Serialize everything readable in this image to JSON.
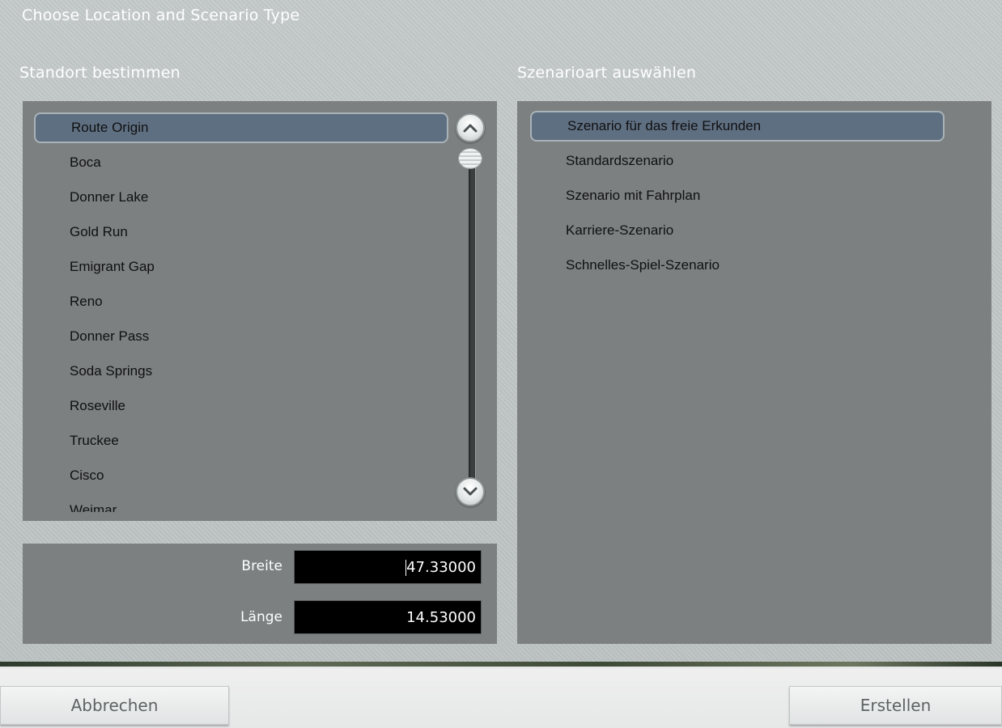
{
  "window": {
    "title": "Choose Location and Scenario Type"
  },
  "location": {
    "heading": "Standort bestimmen",
    "items": [
      "Route Origin",
      "Boca",
      "Donner Lake",
      "Gold Run",
      "Emigrant Gap",
      "Reno",
      "Donner Pass",
      "Soda Springs",
      "Roseville",
      "Truckee",
      "Cisco",
      "Weimar"
    ],
    "selected_index": 0
  },
  "coordinates": {
    "latitude_label": "Breite",
    "latitude_value": "47.33000",
    "longitude_label": "Länge",
    "longitude_value": "14.53000"
  },
  "scenario": {
    "heading": "Szenarioart auswählen",
    "items": [
      "Szenario für das freie Erkunden",
      "Standardszenario",
      "Szenario mit Fahrplan",
      "Karriere-Szenario",
      "Schnelles-Spiel-Szenario"
    ],
    "selected_index": 0
  },
  "buttons": {
    "cancel": "Abbrechen",
    "create": "Erstellen"
  },
  "icons": {
    "scroll_up": "chevron-up-icon",
    "scroll_down": "chevron-down-icon"
  }
}
